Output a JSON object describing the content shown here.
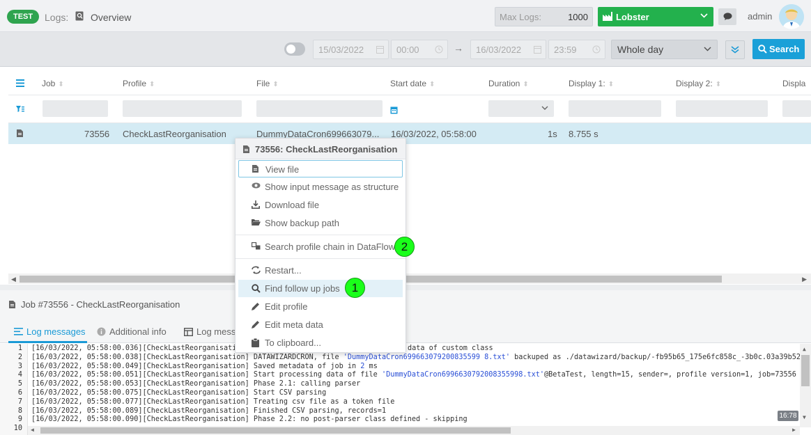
{
  "header": {
    "env_badge": "TEST",
    "breadcrumb_section": "Logs:",
    "breadcrumb_title": "Overview",
    "max_logs_label": "Max Logs:",
    "max_logs_value": "1000",
    "server_name": "Lobster",
    "user": "admin"
  },
  "filters": {
    "from_date": "15/03/2022",
    "from_time": "00:00",
    "to_date": "16/03/2022",
    "to_time": "23:59",
    "range": "Whole day",
    "search_label": "Search"
  },
  "table": {
    "columns": [
      "Job",
      "Profile",
      "File",
      "Start date",
      "Duration",
      "Display 1:",
      "Display 2:",
      "Displa"
    ],
    "rows": [
      {
        "job": "73556",
        "profile": "CheckLastReorganisation",
        "file": "DummyDataCron699663079...",
        "start": "16/03/2022, 05:58:00",
        "duration": "1s",
        "display1": "8.755 s"
      }
    ]
  },
  "context_menu": {
    "title": "73556: CheckLastReorganisation",
    "items": [
      {
        "label": "View file",
        "icon": "file-icon"
      },
      {
        "label": "Show input message as structure",
        "icon": "eye-icon"
      },
      {
        "label": "Download file",
        "icon": "download-icon"
      },
      {
        "label": "Show backup path",
        "icon": "folder-icon"
      },
      {
        "label": "Search profile chain in DataFlow",
        "icon": "chain-icon"
      },
      {
        "label": "Restart...",
        "icon": "restart-icon"
      },
      {
        "label": "Find follow up jobs",
        "icon": "search-icon"
      },
      {
        "label": "Edit profile",
        "icon": "pencil-icon"
      },
      {
        "label": "Edit meta data",
        "icon": "pencil-icon"
      },
      {
        "label": "To clipboard...",
        "icon": "clipboard-icon"
      }
    ],
    "marker_1": "1",
    "marker_2": "2"
  },
  "job_panel": {
    "title": "Job #73556 - CheckLastReorganisation",
    "tabs": [
      "Log messages",
      "Additional info",
      "Log mess"
    ]
  },
  "log": {
    "lines": [
      {
        "n": "1",
        "pre": "[16/03/2022, 05:58:00.036][CheckLastReorganisatio",
        "str": "",
        "post": "",
        "tail": "data of custom class"
      },
      {
        "n": "2",
        "pre": "[16/03/2022, 05:58:00.038][CheckLastReorganisation] DATAWIZARDCRON, file ",
        "str": "'DummyDataCron699663079200835599 8.txt'",
        "post": " backuped as ./datawizard/backup/-fb95b65_175e6fc858c_-3b0c.03a39b52",
        "tail": ""
      },
      {
        "n": "3",
        "pre": "[16/03/2022, 05:58:00.049][CheckLastReorganisation] Saved metadata of job in ",
        "str": "2",
        "post": " ms",
        "tail": ""
      },
      {
        "n": "4",
        "pre": "[16/03/2022, 05:58:00.051][CheckLastReorganisation] Start processing data of file ",
        "str": "'DummyDataCron6996630792008355998.txt'",
        "post": "@BetaTest, length=15, sender=, profile version=1, job=73556",
        "tail": ""
      },
      {
        "n": "5",
        "pre": "[16/03/2022, 05:58:00.053][CheckLastReorganisation] Phase 2.1: calling parser",
        "str": "",
        "post": "",
        "tail": ""
      },
      {
        "n": "6",
        "pre": "[16/03/2022, 05:58:00.075][CheckLastReorganisation] Start CSV parsing",
        "str": "",
        "post": "",
        "tail": ""
      },
      {
        "n": "7",
        "pre": "[16/03/2022, 05:58:00.077][CheckLastReorganisation] Treating csv file as a token file",
        "str": "",
        "post": "",
        "tail": ""
      },
      {
        "n": "8",
        "pre": "[16/03/2022, 05:58:00.089][CheckLastReorganisation] Finished CSV parsing, records=1",
        "str": "",
        "post": "",
        "tail": ""
      },
      {
        "n": "9",
        "pre": "[16/03/2022, 05:58:00.090][CheckLastReorganisation] Phase 2.2: no post-parser class defined - skipping",
        "str": "",
        "post": "",
        "tail": ""
      },
      {
        "n": "10",
        "pre": "",
        "str": "",
        "post": "",
        "tail": ""
      }
    ],
    "cursor_pos": "16:78"
  }
}
